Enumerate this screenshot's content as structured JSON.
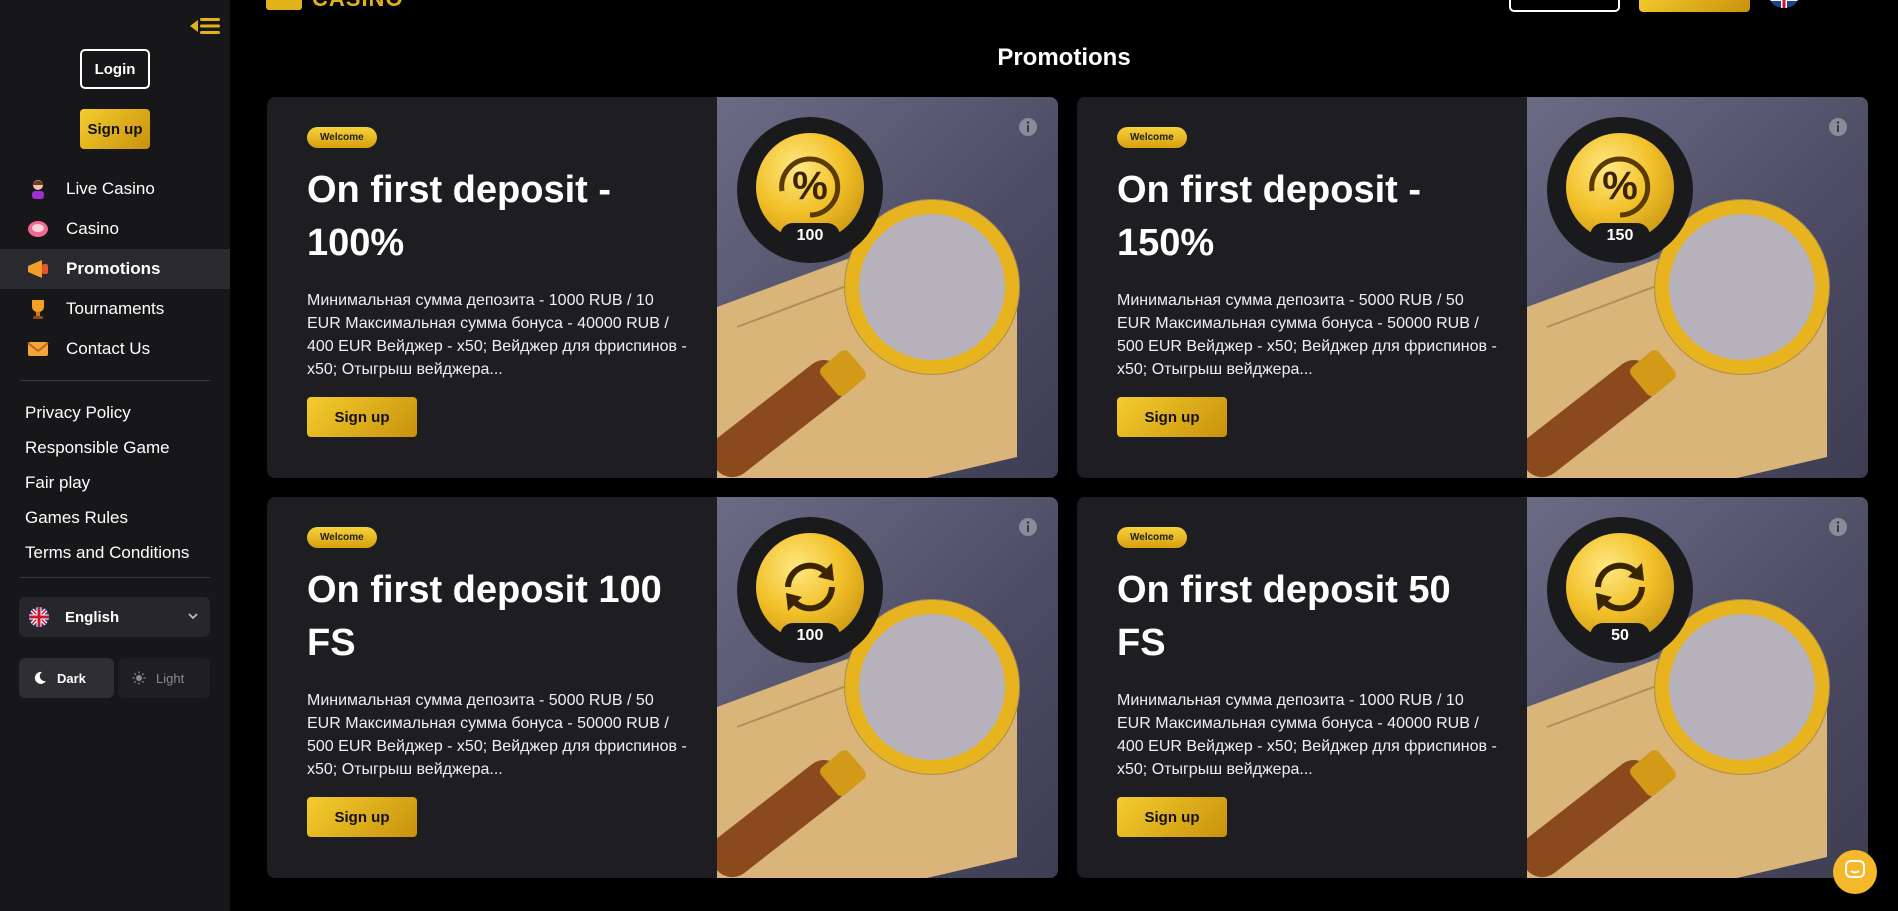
{
  "brand": {
    "logo_text": "CASINO"
  },
  "sidebar": {
    "login_label": "Login",
    "signup_label": "Sign up",
    "nav": [
      {
        "label": "Live Casino",
        "icon": "live-casino-icon",
        "active": false
      },
      {
        "label": "Casino",
        "icon": "casino-chip-icon",
        "active": false
      },
      {
        "label": "Promotions",
        "icon": "megaphone-icon",
        "active": true
      },
      {
        "label": "Tournaments",
        "icon": "trophy-icon",
        "active": false
      },
      {
        "label": "Contact Us",
        "icon": "envelope-icon",
        "active": false
      }
    ],
    "links": [
      "Privacy Policy",
      "Responsible Game",
      "Fair play",
      "Games Rules",
      "Terms and Conditions"
    ],
    "language": {
      "label": "English",
      "icon": "uk-flag-icon"
    },
    "theme": {
      "dark_label": "Dark",
      "light_label": "Light",
      "selected": "Dark"
    }
  },
  "page": {
    "title": "Promotions"
  },
  "promotions": [
    {
      "badge": "Welcome",
      "title": "On first deposit - 100%",
      "description": "Минимальная сумма депозита - 1000 RUB / 10 EUR Максимальная сумма бонуса - 40000 RUB / 400 EUR Вейджер - x50; Вейджер для фриспинов - x50; Отыгрыш вейджера...",
      "button": "Sign up",
      "coin_value": "100",
      "coin_icon": "percent-icon"
    },
    {
      "badge": "Welcome",
      "title": "On first deposit - 150%",
      "description": "Минимальная сумма депозита - 5000 RUB / 50 EUR Максимальная сумма бонуса - 50000 RUB / 500 EUR Вейджер - x50; Вейджер для фриспинов - x50; Отыгрыш вейджера...",
      "button": "Sign up",
      "coin_value": "150",
      "coin_icon": "percent-icon"
    },
    {
      "badge": "Welcome",
      "title": "On first deposit 100 FS",
      "description": "Минимальная сумма депозита - 5000 RUB / 50 EUR Максимальная сумма бонуса - 50000 RUB / 500 EUR Вейджер - x50; Вейджер для фриспинов - x50; Отыгрыш вейджера...",
      "button": "Sign up",
      "coin_value": "100",
      "coin_icon": "refresh-icon"
    },
    {
      "badge": "Welcome",
      "title": "On first deposit 50 FS",
      "description": "Минимальная сумма депозита - 1000 RUB / 10 EUR Максимальная сумма бонуса - 40000 RUB / 400 EUR Вейджер - x50; Вейджер для фриспинов - x50; Отыгрыш вейджера...",
      "button": "Sign up",
      "coin_value": "50",
      "coin_icon": "refresh-icon"
    }
  ],
  "colors": {
    "accent": "#f2c12a",
    "sidebar_bg": "#17171a",
    "card_bg": "#1e1e22"
  }
}
